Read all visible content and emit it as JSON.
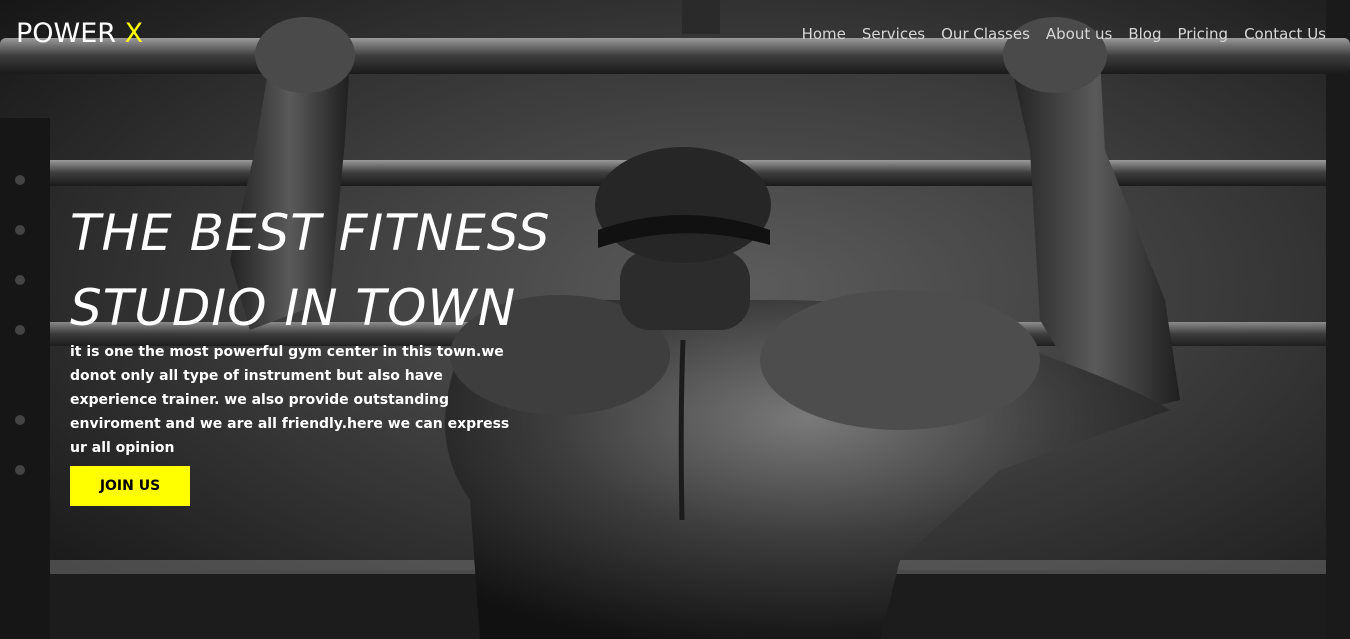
{
  "brand": {
    "name": "POWER",
    "accent": "X",
    "accent_color": "#ffff00"
  },
  "nav": {
    "items": [
      {
        "label": "Home"
      },
      {
        "label": "Services"
      },
      {
        "label": "Our Classes"
      },
      {
        "label": "About us"
      },
      {
        "label": "Blog"
      },
      {
        "label": "Pricing"
      },
      {
        "label": "Contact Us"
      }
    ]
  },
  "hero": {
    "headline_line1": "THE BEST FITNESS",
    "headline_line2": "STUDIO IN TOWN",
    "description": "it is one the most powerful gym center in this town.we donot only all type of instrument but also have experience trainer. we also provide outstanding enviroment and we are all friendly.here we can express ur all opinion",
    "cta_label": "JOIN US",
    "cta_color": "#ffff00"
  }
}
